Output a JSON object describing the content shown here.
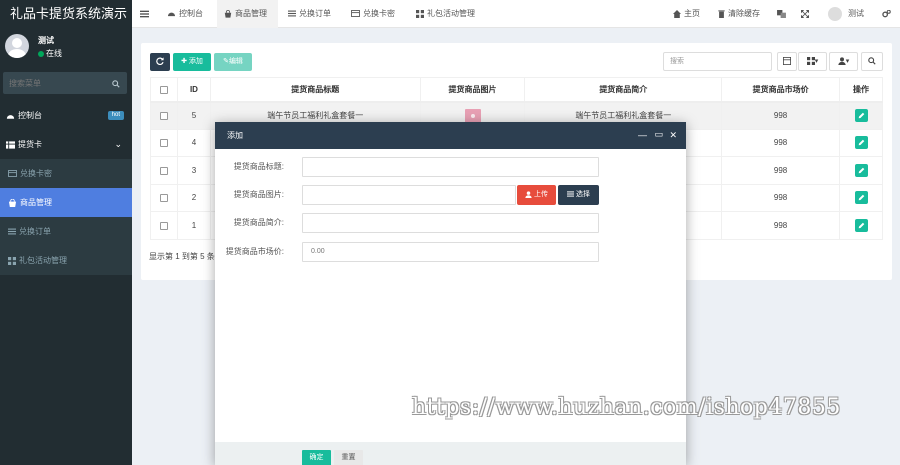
{
  "app": {
    "title": "礼品卡提货系统演示"
  },
  "user": {
    "name": "测试",
    "status": "在线"
  },
  "sidebar": {
    "search_placeholder": "搜索菜单",
    "items": [
      {
        "label": "控制台",
        "badge": "hot"
      },
      {
        "label": "提货卡"
      },
      {
        "label": "兑换卡密"
      },
      {
        "label": "商品管理"
      },
      {
        "label": "兑换订单"
      },
      {
        "label": "礼包活动管理"
      }
    ]
  },
  "topbar": {
    "tabs": [
      {
        "label": "控制台"
      },
      {
        "label": "商品管理"
      },
      {
        "label": "兑换订单"
      },
      {
        "label": "兑换卡密"
      },
      {
        "label": "礼包活动管理"
      }
    ],
    "home_label": "主页",
    "clear_cache_label": "清除缓存",
    "user_label": "测试"
  },
  "toolbar": {
    "add_label": "添加",
    "edit_label": "编辑",
    "search_placeholder": "搜索"
  },
  "table": {
    "headers": [
      "ID",
      "提货商品标题",
      "提货商品图片",
      "提货商品简介",
      "提货商品市场价",
      "操作"
    ],
    "rows": [
      {
        "id": "5",
        "title": "端午节员工福利礼盒套餐一",
        "intro": "端午节员工福利礼盒套餐一",
        "price": "998"
      },
      {
        "id": "4",
        "title": "",
        "intro": "",
        "price": "998"
      },
      {
        "id": "3",
        "title": "",
        "intro": "",
        "price": "998"
      },
      {
        "id": "2",
        "title": "",
        "intro": "",
        "price": "998"
      },
      {
        "id": "1",
        "title": "",
        "intro": "",
        "price": "998"
      }
    ],
    "pagination": "显示第 1 到第 5 条"
  },
  "modal": {
    "title": "添加",
    "fields": {
      "title_label": "提货商品标题:",
      "image_label": "提货商品图片:",
      "intro_label": "提货商品简介:",
      "price_label": "提货商品市场价:",
      "price_value": "0.00"
    },
    "upload_label": "上传",
    "select_label": "选择",
    "confirm_label": "确定",
    "reset_label": "重置"
  },
  "watermark": "https://www.huzhan.com/ishop47855",
  "colors": {
    "sidebar_bg": "#222d32",
    "active_menu": "#4f7ee0",
    "success": "#18bc9c",
    "danger": "#e74c3c",
    "dark": "#2c3e50"
  }
}
